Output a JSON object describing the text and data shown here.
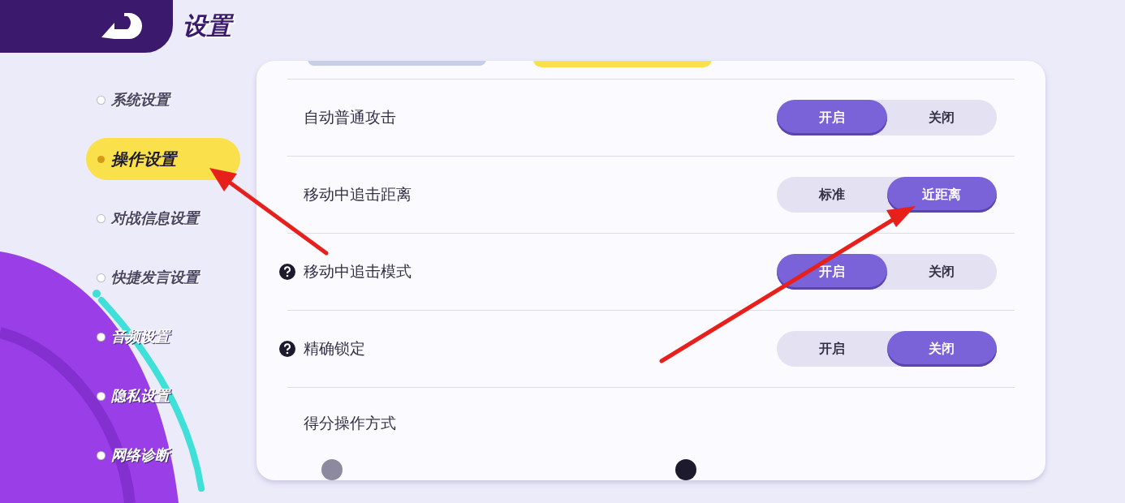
{
  "header": {
    "title": "设置"
  },
  "sidebar": {
    "items": [
      {
        "label": "系统设置",
        "selected": false
      },
      {
        "label": "操作设置",
        "selected": true
      },
      {
        "label": "对战信息设置",
        "selected": false
      },
      {
        "label": "快捷发言设置",
        "selected": false
      },
      {
        "label": "音频设置",
        "selected": false
      },
      {
        "label": "隐私设置",
        "selected": false
      },
      {
        "label": "网络诊断",
        "selected": false
      }
    ]
  },
  "top_buttons": [
    {
      "selected": false
    },
    {
      "selected": true
    }
  ],
  "settings": [
    {
      "label": "自动普通攻击",
      "help": false,
      "options": [
        {
          "label": "开启",
          "selected": true
        },
        {
          "label": "关闭",
          "selected": false
        }
      ]
    },
    {
      "label": "移动中追击距离",
      "help": false,
      "options": [
        {
          "label": "标准",
          "selected": false
        },
        {
          "label": "近距离",
          "selected": true
        }
      ]
    },
    {
      "label": "移动中追击模式",
      "help": true,
      "options": [
        {
          "label": "开启",
          "selected": true
        },
        {
          "label": "关闭",
          "selected": false
        }
      ]
    },
    {
      "label": "精确锁定",
      "help": true,
      "options": [
        {
          "label": "开启",
          "selected": false
        },
        {
          "label": "关闭",
          "selected": true
        }
      ]
    }
  ],
  "scoring": {
    "label": "得分操作方式",
    "options": [
      {
        "selected": false
      },
      {
        "selected": true
      }
    ]
  }
}
